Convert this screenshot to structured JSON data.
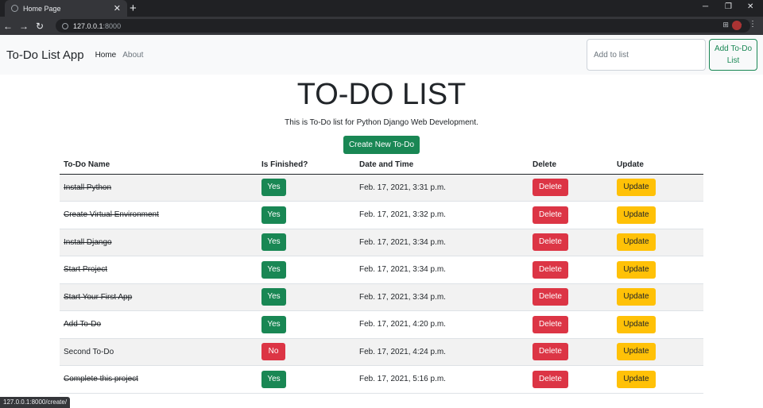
{
  "browser": {
    "tab_title": "Home Page",
    "tab_close": "✕",
    "new_tab": "+",
    "url_host": "127.0.0.1",
    "url_port": ":8000",
    "status_url": "127.0.0.1:8000/create/"
  },
  "navbar": {
    "brand": "To-Do List App",
    "links": [
      "Home",
      "About"
    ],
    "input_placeholder": "Add to list",
    "add_button": "Add To-Do List"
  },
  "main": {
    "title": "TO-DO LIST",
    "subtitle": "This is To-Do list for Python Django Web Development.",
    "create_button": "Create New To-Do"
  },
  "table": {
    "headers": [
      "To-Do Name",
      "Is Finished?",
      "Date and Time",
      "Delete",
      "Update"
    ],
    "delete_label": "Delete",
    "update_label": "Update",
    "rows": [
      {
        "name": "Install Python",
        "finished": "Yes",
        "date": "Feb. 17, 2021, 3:31 p.m.",
        "done": true
      },
      {
        "name": "Create Virtual Environment",
        "finished": "Yes",
        "date": "Feb. 17, 2021, 3:32 p.m.",
        "done": true
      },
      {
        "name": "Install Django",
        "finished": "Yes",
        "date": "Feb. 17, 2021, 3:34 p.m.",
        "done": true
      },
      {
        "name": "Start Project",
        "finished": "Yes",
        "date": "Feb. 17, 2021, 3:34 p.m.",
        "done": true
      },
      {
        "name": "Start Your First App",
        "finished": "Yes",
        "date": "Feb. 17, 2021, 3:34 p.m.",
        "done": true
      },
      {
        "name": "Add To-Do",
        "finished": "Yes",
        "date": "Feb. 17, 2021, 4:20 p.m.",
        "done": true
      },
      {
        "name": "Second To-Do",
        "finished": "No",
        "date": "Feb. 17, 2021, 4:24 p.m.",
        "done": false
      },
      {
        "name": "Complete this project",
        "finished": "Yes",
        "date": "Feb. 17, 2021, 5:16 p.m.",
        "done": true
      }
    ]
  },
  "colors": {
    "success": "#198754",
    "danger": "#dc3545",
    "warning": "#ffc107"
  }
}
